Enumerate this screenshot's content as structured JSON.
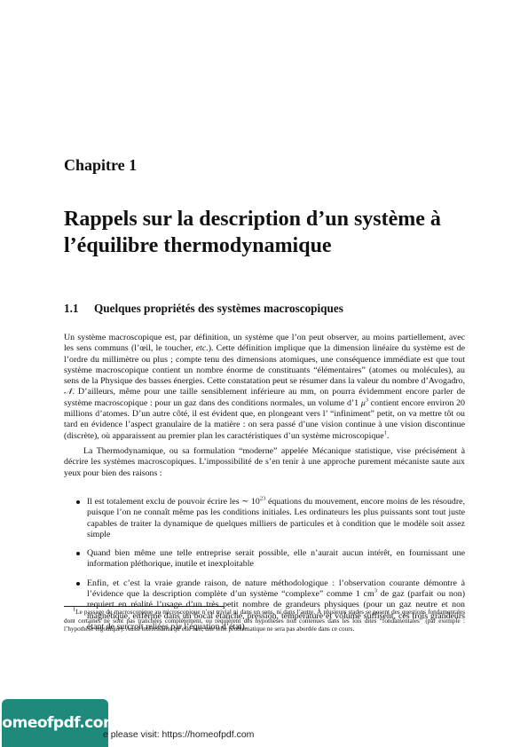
{
  "chapter": {
    "label": "Chapitre 1",
    "title": "Rappels sur la description d’un système à l’équilibre thermodynamique"
  },
  "section": {
    "number": "1.1",
    "title": "Quelques propriétés des systèmes macroscopiques"
  },
  "paragraph1": {
    "text_a": "Un système macroscopique est, par définition, un système que l’on peut observer, au moins partiellement, avec les sens communs (l’œil, le toucher, ",
    "text_etc": "etc.",
    "text_b": "). Cette définition implique que la dimension linéaire du système est de l’ordre du millimètre ou plus ; compte tenu des dimensions atomiques, une conséquence immédiate est que tout système macroscopique contient un nombre énorme de constituants “élémentaires” (atomes ou molécules), au sens de la Physique des basses énergies. Cette constatation peut se résumer dans la valeur du nombre d’Avogadro, ",
    "avogadro": "𝒩",
    "text_c": ". D’ailleurs, même pour une taille sensiblement inférieure au mm, on pourra évidemment encore parler de système macroscopique : pour un gaz dans des conditions normales, un volume d’1 ",
    "mu": "μ",
    "mu_exp": "3",
    "text_d": " contient encore environ 20 millions d’atomes. D’un autre côté, il est évident que, en plongeant vers l’ “infiniment” petit, on va mettre tôt ou tard en évidence l’aspect granulaire de la matière : on sera passé d’une vision continue à une vision discontinue (discrète), où apparaissent au premier plan les caractéristiques d’un système microscopique",
    "footnote_ref": "1",
    "text_e": "."
  },
  "paragraph2": {
    "text": "La Thermodynamique, ou sa formulation “moderne” appelée Mécanique statistique, vise précisément à décrire les systèmes macroscopiques. L’impossibilité de s’en tenir à une approche purement mécaniste saute aux yeux pour bien des raisons :"
  },
  "bullets": [
    {
      "text_a": "Il est totalement exclu de pouvoir écrire les ∼ 10",
      "exp": "23",
      "text_b": " équations du mouvement, encore moins de les résoudre, puisque l’on ne connaît même pas les conditions initiales. Les ordinateurs les plus puissants sont tout juste capables de traiter la dynamique de quelques milliers de particules et à condition que le modèle soit assez simple"
    },
    {
      "text": "Quand bien même une telle entreprise serait possible, elle n’aurait aucun intérêt, en fournissant une information pléthorique, inutile et inexploitable"
    },
    {
      "text_a": "Enfin, et c’est la vraie grande raison, de nature méthodologique : l’observation courante démontre à l’évidence que la description complète d’un système “complexe” comme 1 cm",
      "exp": "3",
      "text_b": " de gaz (parfait ou non) requiert en réalité l’usage d’un très petit nombre de grandeurs physiques (pour un gaz neutre et non magnétique, enfermé dans un bocal étanche, pression, température et volume suffisent, ces trois grandeurs étant de surcroît reliées par l’équation d’état)."
    }
  ],
  "footnote": {
    "mark": "1",
    "text": "Le passage du macroscopique au microscopique n’est trivial ni dans un sens, ni dans l’autre. À plusieurs stades se posent des questions fondamentales dont certaines ne sont pas tranchées complètement, ou requièrent des hypothèses non contenues dans les lois dites “fondamentales” (par exemple : l’hypothèse ergodique). Aussi intéressante qu’elle soit, une telle problématique ne sera pas abordée dans ce cours."
  },
  "watermark": {
    "logo_text": "homeofpdf.com",
    "visit_text": "e please visit: https://homeofpdf.com",
    "logo_color": "#1f8a7b"
  }
}
